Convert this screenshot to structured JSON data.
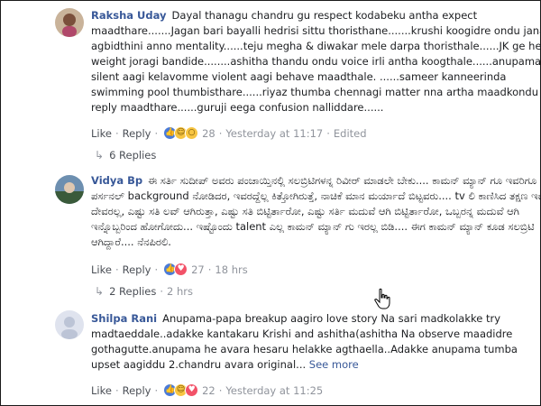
{
  "comments": [
    {
      "author": "Raksha Uday",
      "text": "Dayal thanagu chandru gu respect kodabeku antha expect maadthare.......Jagan bari bayalli hedrisi sittu thoristhane.......krushi koogidre ondu jana agbidthini anno mentality......teju megha & diwakar mele darpa thoristhale......JK ge head weight joragi bandide........ashitha thandu ondu voice irli antha koogthale......anupama silent aagi kelavomme violent aagi behave maadthale. ......sameer kanneerinda swimming pool thumbisthare......riyaz thumba chennagi matter nna artha maadkondu reply maadthare......guruji eega confusion nalliddare......",
      "like": "Like",
      "reply": "Reply",
      "reaction_count": "28",
      "time": "Yesterday at 11:17",
      "edited": "Edited",
      "replies": "6 Replies"
    },
    {
      "author": "Vidya Bp",
      "text": "ಈ ಸರ್ತಿ ಸುದೀಪ್ ಅವರು ಪಂಚಾಯ್ತಿನಲ್ಲಿ ಸಲಬ್ರಿಟಿಗಳನ್ನ ರಿವೀರ್ ಮಾಡಲೇ ಬೇಕು.... ಕಾಮನ್ ಮ್ಯಾನ್ ಗೂ ಇವರಿಗೂ ಪರ್ಸನಲ್ background ನೋಡಿದರ, ಇವರದ್ದೆಲ್ಲ ಕಿತ್ತೋಗಿರುತ್ತೆ, ನಾಚಿಕೆ ಮಾನ ಮರ್ಯಾದೆ ಬಿಟ್ಟವರು.... tv ಲಿ ಕಾಣಿಸಿದ ತಕ್ಷಣ ಇವರಲ್ಲ ದೇವರಲ್ಲ, ಎಷ್ಟು ಸತಿ ಲವ್ ಆಗಿರುತ್ತಾ, ಎಷ್ಟು ಸತಿ ಬಿಟ್ಟಿರ್ತಾರೋ, ಎಷ್ಟು ಸರ್ತಿ ಮದುವೆ ಆಗಿ ಬಿಟ್ಟಿರ್ತಾರೋ, ಒಬ್ಬರನ್ನ ಮದುವೆ ಆಗಿ ಇನ್ನೊಬ್ಬರಿಂದ ಹೋಗೋದು... ಇಷ್ಟೊಂದು talent ಎಲ್ಲ ಕಾಮನ್ ಮ್ಯಾನ್ ಗು ಇರಲ್ಲ ಬಿಡಿ.... ಈಗ ಕಾಮನ್ ಮ್ಯಾನ್ ಕೂಡ ಸಲಬ್ರಿಟಿ ಆಗಿದ್ದಾರೆ.... ನೆನಪಿರಲಿ.",
      "like": "Like",
      "reply": "Reply",
      "reaction_count": "27",
      "time": "18 hrs",
      "replies": "2 Replies",
      "replies_time": "2 hrs"
    },
    {
      "author": "Shilpa Rani",
      "text": "Anupama-papa breakup aagiro love story Na sari madkolakke try madtaeddale..adakke kantakaru Krishi and ashitha(ashitha Na observe maadidre gothagutte.anupama he avara hesaru helakke agthaella..Adakke anupama tumba upset aagiddu 2.chandru avara original...",
      "see_more": "See more",
      "like": "Like",
      "reply": "Reply",
      "reaction_count": "22",
      "time": "Yesterday at 11:25"
    }
  ],
  "separator": "·",
  "icons": {
    "reactions_1": [
      "like",
      "haha",
      "wow"
    ],
    "reactions_2": [
      "like",
      "love"
    ],
    "reactions_3": [
      "like",
      "haha",
      "love"
    ],
    "reply_arrow": "reply-arrow-icon",
    "cursor": "hand-pointer-icon"
  },
  "colors": {
    "author": "#385898",
    "text": "#1c1e21",
    "meta": "#90949c"
  }
}
